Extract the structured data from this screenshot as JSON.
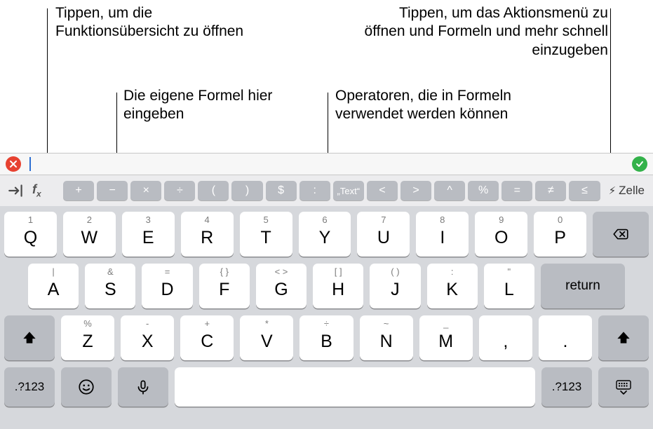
{
  "annotations": {
    "top_left": "Tippen, um die Funktionsübersicht zu öffnen",
    "top_right": "Tippen, um das Aktionsmenü zu öffnen und Formeln und mehr schnell einzugeben",
    "mid_left": "Die eigene Formel hier eingeben",
    "mid_right": "Operatoren, die in Formeln verwendet werden können"
  },
  "formula_bar": {
    "cancel_icon": "close-icon",
    "confirm_icon": "check-icon",
    "field_value": ""
  },
  "toolbar": {
    "fx_label": "fx",
    "operators": [
      "+",
      "−",
      "×",
      "÷",
      "(",
      ")",
      "$",
      ":",
      "„Text“",
      "<",
      ">",
      "^",
      "%",
      "=",
      "≠",
      "≤"
    ],
    "zelle_label": "Zelle"
  },
  "keyboard": {
    "row1": [
      {
        "alt": "1",
        "main": "Q"
      },
      {
        "alt": "2",
        "main": "W"
      },
      {
        "alt": "3",
        "main": "E"
      },
      {
        "alt": "4",
        "main": "R"
      },
      {
        "alt": "5",
        "main": "T"
      },
      {
        "alt": "6",
        "main": "Y"
      },
      {
        "alt": "7",
        "main": "U"
      },
      {
        "alt": "8",
        "main": "I"
      },
      {
        "alt": "9",
        "main": "O"
      },
      {
        "alt": "0",
        "main": "P"
      }
    ],
    "row2": [
      {
        "alt": "|",
        "main": "A"
      },
      {
        "alt": "&",
        "main": "S"
      },
      {
        "alt": "=",
        "main": "D"
      },
      {
        "alt": "{ }",
        "main": "F"
      },
      {
        "alt": "< >",
        "main": "G"
      },
      {
        "alt": "[ ]",
        "main": "H"
      },
      {
        "alt": "( )",
        "main": "J"
      },
      {
        "alt": ":",
        "main": "K"
      },
      {
        "alt": "\"",
        "main": "L"
      }
    ],
    "row3": [
      {
        "alt": "%",
        "main": "Z"
      },
      {
        "alt": "-",
        "main": "X"
      },
      {
        "alt": "+",
        "main": "C"
      },
      {
        "alt": "*",
        "main": "V"
      },
      {
        "alt": "÷",
        "main": "B"
      },
      {
        "alt": "~",
        "main": "N"
      },
      {
        "alt": "_",
        "main": "M"
      },
      {
        "alt": "",
        "main": ","
      },
      {
        "alt": "",
        "main": "."
      }
    ],
    "mode_label": ".?123",
    "return_label": "return"
  }
}
